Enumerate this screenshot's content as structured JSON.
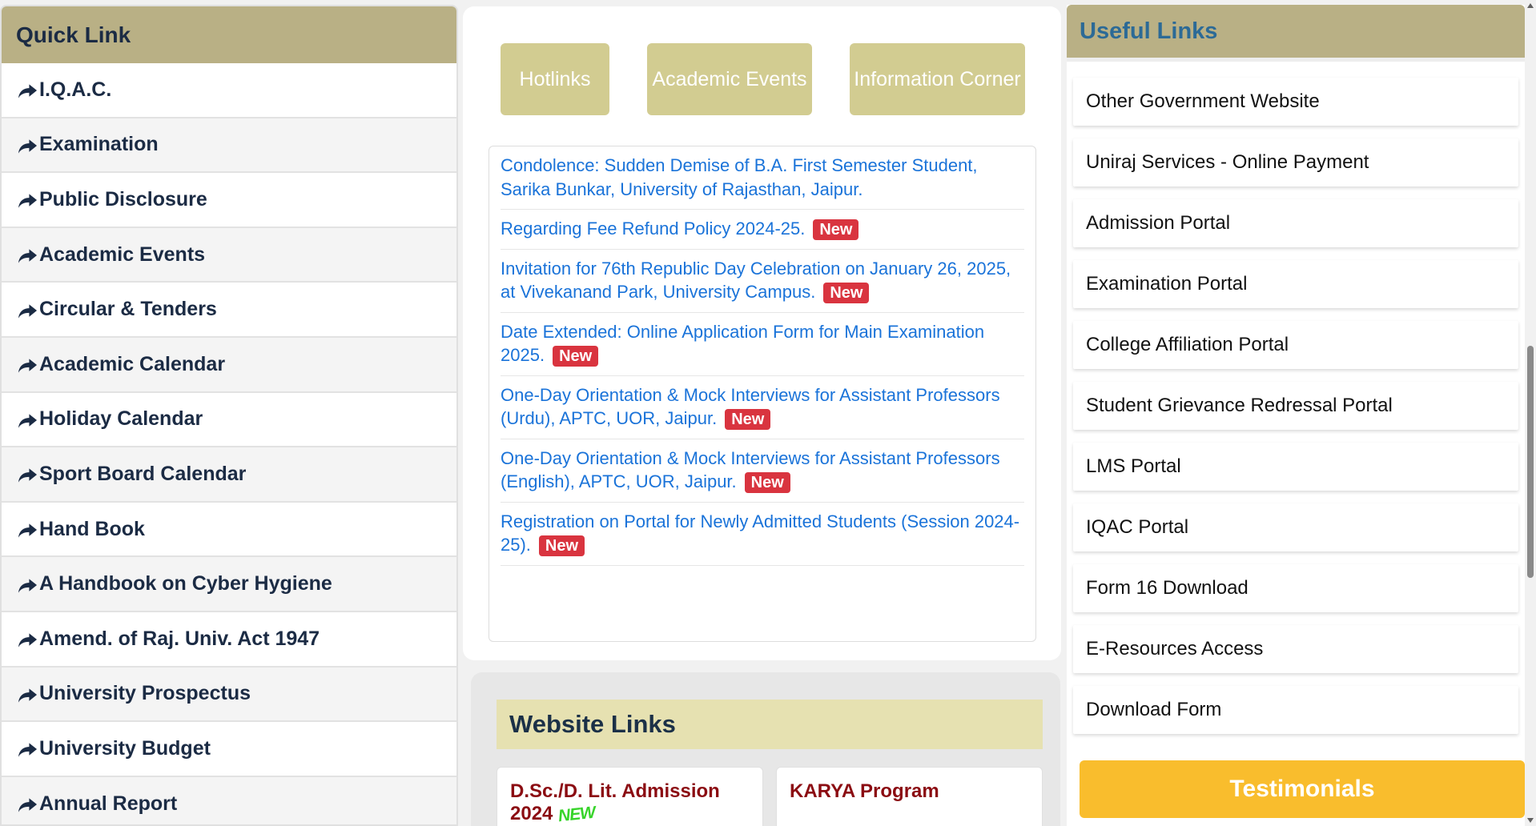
{
  "quick_link": {
    "title": "Quick Link",
    "items": [
      "I.Q.A.C.",
      "Examination",
      "Public Disclosure",
      "Academic Events",
      "Circular & Tenders",
      "Academic Calendar",
      "Holiday Calendar",
      "Sport Board Calendar",
      "Hand Book",
      "A Handbook on Cyber Hygiene",
      "Amend. of Raj. Univ. Act 1947",
      "University Prospectus",
      "University Budget",
      "Annual Report"
    ],
    "icon": "share-arrow-icon"
  },
  "tabs": {
    "hotlinks": "Hotlinks",
    "academic_events": "Academic Events",
    "information_corner": "Information Corner"
  },
  "news": [
    {
      "text": "Condolence: Sudden Demise of B.A. First Semester Student, Sarika Bunkar, University of Rajasthan, Jaipur.",
      "badge": ""
    },
    {
      "text": "Regarding Fee Refund Policy 2024-25.",
      "badge": "New"
    },
    {
      "text": "Invitation for 76th Republic Day Celebration on January 26, 2025, at Vivekanand Park, University Campus.",
      "badge": "New"
    },
    {
      "text": "Date Extended: Online Application Form for Main Examination 2025.",
      "badge": "New"
    },
    {
      "text": "One-Day Orientation & Mock Interviews for Assistant Professors (Urdu), APTC, UOR, Jaipur.",
      "badge": "New"
    },
    {
      "text": "One-Day Orientation & Mock Interviews for Assistant Professors (English), APTC, UOR, Jaipur.",
      "badge": "New"
    },
    {
      "text": "Registration on Portal for Newly Admitted Students (Session 2024-25).",
      "badge": "New"
    }
  ],
  "website_links": {
    "title": "Website Links",
    "cards": [
      {
        "title": "D.Sc./D. Lit. Admission 2024",
        "badge": "NEW"
      },
      {
        "title": "KARYA Program",
        "badge": ""
      }
    ]
  },
  "useful_links": {
    "title": "Useful Links",
    "items": [
      "Other Government Website",
      "Uniraj Services - Online Payment",
      "Admission Portal",
      "Examination Portal",
      "College Affiliation Portal",
      "Student Grievance Redressal Portal",
      "LMS Portal",
      "IQAC Portal",
      "Form 16 Download",
      "E-Resources Access",
      "Download Form"
    ],
    "testimonials": "Testimonials"
  },
  "colors": {
    "header_khaki": "#b9b085",
    "tab_khaki": "#d2cc91",
    "link_blue": "#1a73d9",
    "badge_red": "#d9343f",
    "testimonial_yellow": "#f9bd2d",
    "useful_title_blue": "#2c6a96"
  }
}
